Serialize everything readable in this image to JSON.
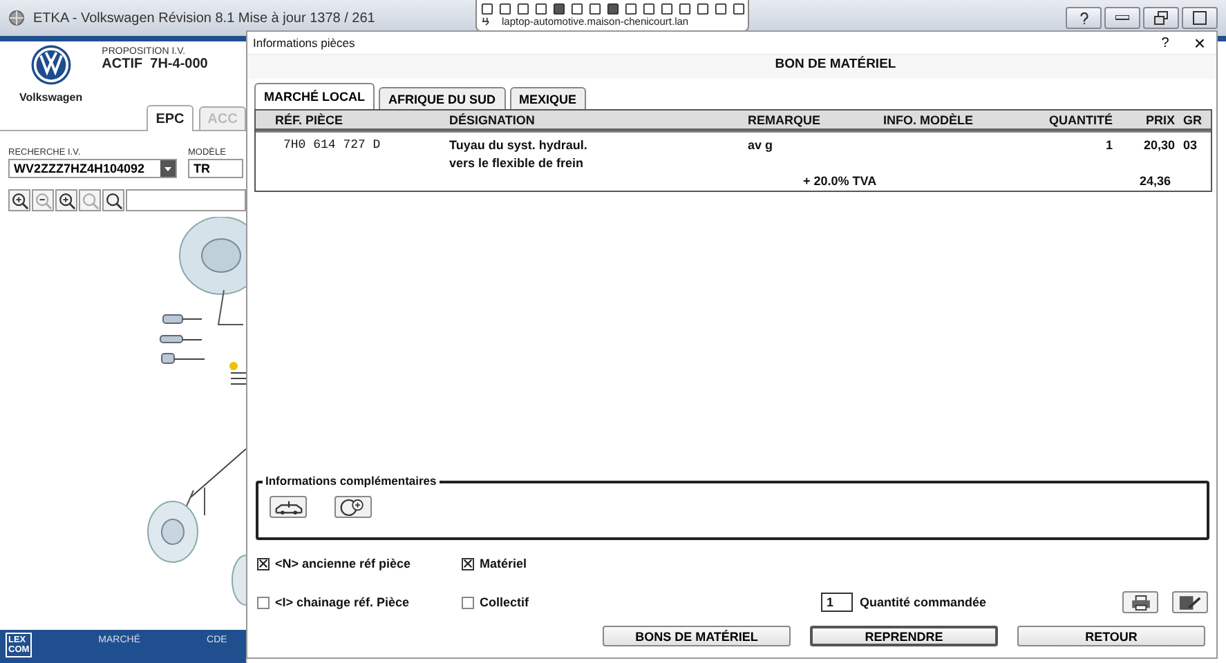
{
  "app_window": {
    "title": "ETKA - Volkswagen Révision 8.1 Mise à jour 1378 / 261"
  },
  "remote_toolbar": {
    "host": "laptop-automotive.maison-chenicourt.lan"
  },
  "app": {
    "brand": "Volkswagen",
    "proposition_label": "PROPOSITION I.V.",
    "proposition_value": "ACTIF  7H-4-000",
    "tabs": [
      {
        "label": "EPC",
        "selected": true
      },
      {
        "label": "ACC",
        "selected": false
      }
    ],
    "search": {
      "label": "RECHERCHE I.V.",
      "value": "WV2ZZZ7HZ4H104092"
    },
    "model": {
      "label": "MODÈLE",
      "value": "TR"
    },
    "bottom_bar": {
      "logo": [
        "LEX",
        "COM"
      ],
      "items": [
        "MARCHÉ",
        "CDE"
      ]
    }
  },
  "dialog": {
    "title": "Informations pièces",
    "help": "?",
    "close": "×",
    "heading": "BON DE MATÉRIEL",
    "tabs": [
      {
        "label": "MARCHÉ LOCAL",
        "selected": true
      },
      {
        "label": "AFRIQUE DU SUD",
        "selected": false
      },
      {
        "label": "MEXIQUE",
        "selected": false
      }
    ],
    "table": {
      "columns": [
        "RÉF. PIÈCE",
        "DÉSIGNATION",
        "REMARQUE",
        "INFO. MODÈLE",
        "QUANTITÉ",
        "PRIX",
        "GR"
      ],
      "rows": [
        {
          "ref": "7H0 614 727 D",
          "designation": [
            "Tuyau du syst. hydraul.",
            "vers le flexible de frein"
          ],
          "remark": "av g",
          "quantity": "1",
          "price": "20,30",
          "group": "03"
        }
      ],
      "tax": {
        "label": "+ 20.0% TVA",
        "price": "24,36"
      }
    },
    "extra_info": {
      "title": "Informations complémentaires"
    },
    "options": [
      {
        "label": "<N> ancienne réf pièce",
        "checked": true
      },
      {
        "label": "Matériel",
        "checked": true
      },
      {
        "label": "<I> chainage réf. Pièce",
        "checked": false
      },
      {
        "label": "Collectif",
        "checked": false
      }
    ],
    "quantity": {
      "value": "1",
      "label": "Quantité commandée"
    },
    "buttons": [
      {
        "label": "BONS DE MATÉRIEL",
        "default": false
      },
      {
        "label": "REPRENDRE",
        "default": true
      },
      {
        "label": "RETOUR",
        "default": false
      }
    ]
  }
}
